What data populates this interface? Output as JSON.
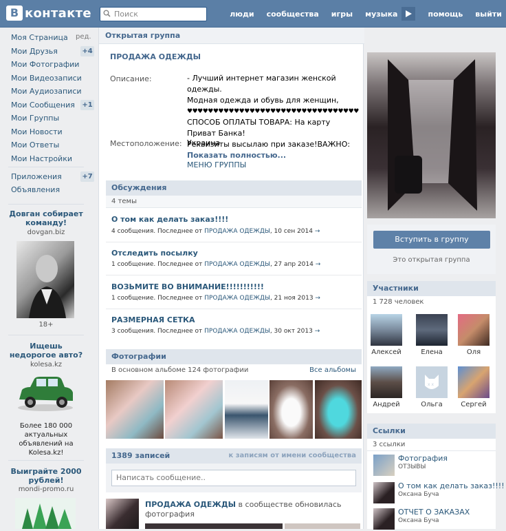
{
  "topbar": {
    "logo_letter": "В",
    "logo_text": "контакте",
    "search_placeholder": "Поиск",
    "nav": [
      "люди",
      "сообщества",
      "игры",
      "музыка",
      "помощь",
      "выйти"
    ]
  },
  "left_menu": {
    "items": [
      {
        "label": "Моя Страница",
        "extra": "ред."
      },
      {
        "label": "Мои Друзья",
        "count": "+4"
      },
      {
        "label": "Мои Фотографии"
      },
      {
        "label": "Мои Видеозаписи"
      },
      {
        "label": "Мои Аудиозаписи"
      },
      {
        "label": "Мои Сообщения",
        "count": "+1"
      },
      {
        "label": "Мои Группы"
      },
      {
        "label": "Мои Новости"
      },
      {
        "label": "Мои Ответы"
      },
      {
        "label": "Мои Настройки"
      },
      {
        "label": "Приложения",
        "count": "+7"
      },
      {
        "label": "Объявления"
      }
    ]
  },
  "ads": [
    {
      "title": "Довган собирает команду!",
      "site": "dovgan.biz",
      "note": "18+"
    },
    {
      "title": "Ищешь недорогое авто?",
      "site": "kolesa.kz",
      "text": "Более 180 000 актуальных объявлений на Kolesa.kz!"
    },
    {
      "title": "Выиграйте 2000 рублей!",
      "site": "mondi-promo.ru"
    }
  ],
  "group": {
    "tab": "Открытая группа",
    "name": "ПРОДАЖА ОДЕЖДЫ",
    "desc_label": "Описание:",
    "desc_lines": [
      "- Лучший интернет магазин женской одежды.",
      "Модная одежда и обувь для женщин,",
      "♥♥♥♥♥♥♥♥♥♥♥♥♥♥♥♥♥♥♥♥♥♥♥♥♥♥♥♥♥♥♥♥♥♥\\",
      "СПОСОБ ОПЛАТЫ ТОВАРА: На карту Приват Банка!",
      "Реквизиты высылаю при заказе!ВАЖНО:"
    ],
    "show_more": "Показать полностью...",
    "loc_label": "Местоположение:",
    "loc_value": "Украина",
    "menu_link": "МЕНЮ ГРУППЫ"
  },
  "discussions": {
    "title": "Обсуждения",
    "count": "4 темы",
    "topics": [
      {
        "title": "О том как делать заказ!!!!",
        "meta": "4 сообщения. Последнее от ",
        "by": "ПРОДАЖА ОДЕЖДЫ",
        "date": ", 10 сен 2014"
      },
      {
        "title": "Отследить посылку",
        "meta": "1 сообщение. Последнее от ",
        "by": "ПРОДАЖА ОДЕЖДЫ",
        "date": ", 27 апр 2014"
      },
      {
        "title": "ВОЗЬМИТЕ ВО ВНИМАНИЕ!!!!!!!!!!!",
        "meta": "1 сообщение. Последнее от ",
        "by": "ПРОДАЖА ОДЕЖДЫ",
        "date": ", 21 ноя 2013"
      },
      {
        "title": "РАЗМЕРНАЯ СЕТКА",
        "meta": "3 сообщения. Последнее от ",
        "by": "ПРОДАЖА ОДЕЖДЫ",
        "date": ", 30 окт 2013"
      }
    ]
  },
  "photos": {
    "title": "Фотографии",
    "subtitle": "В основном альбоме 124 фотографии",
    "all_link": "Все альбомы"
  },
  "wall": {
    "count": "1389 записей",
    "filter": "к записям от имени сообщества",
    "input_placeholder": "Написать сообщение..",
    "post_author": "ПРОДАЖА ОДЕЖДЫ",
    "post_text": " в сообществе обновилась",
    "post_text2": "фотография"
  },
  "join": {
    "button": "Вступить в группу",
    "note": "Это открытая группа"
  },
  "members": {
    "title": "Участники",
    "count": "1 728 человек",
    "list": [
      "Алексей",
      "Елена",
      "Оля",
      "Андрей",
      "Ольга",
      "Сергей"
    ]
  },
  "links": {
    "title": "Ссылки",
    "count": "3 ссылки",
    "list": [
      {
        "title": "Фотография",
        "sub": "ОТЗЫВЫ"
      },
      {
        "title": "О том как делать заказ!!!!",
        "sub": "Оксана Буча"
      },
      {
        "title": "ОТЧЕТ О ЗАКАЗАХ",
        "sub": "Оксана Буча"
      }
    ]
  },
  "colors": {
    "header": "#5b7fa6",
    "link": "#2b587a",
    "section_bg": "#dfe5ec",
    "button": "#5e81a8"
  }
}
